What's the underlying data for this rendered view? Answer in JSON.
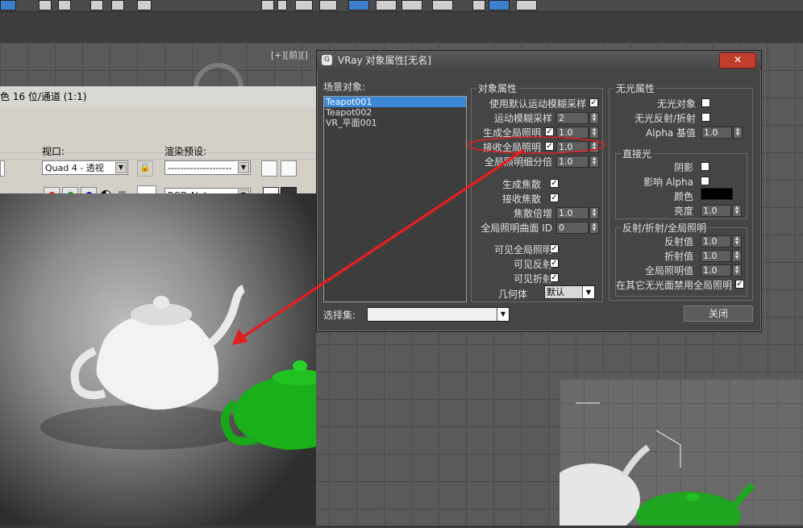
{
  "viewport": {
    "label": "[+][前][]"
  },
  "render_frame": {
    "title_visible": "色 16 位/通道 (1:1)",
    "viewport_label": "视口:",
    "viewport_value": "Quad 4 - 透视",
    "preset_label": "渲染预设:",
    "preset_value": "--------------------",
    "channel_value": "RGB Alpha"
  },
  "dialog": {
    "title": "VRay 对象属性[无名]",
    "close_label": "关闭",
    "scene_objects_label": "场景对象:",
    "objects": [
      "Teapot001",
      "Teapot002",
      "VR_平面001"
    ],
    "selected_object": "Teapot001",
    "selection_set_label": "选择集:",
    "obj_props": {
      "title": "对象属性",
      "use_default_mb": "使用默认运动模糊采样",
      "mb_samples": "运动模糊采样",
      "mb_samples_value": "2",
      "gen_gi": "生成全局照明",
      "gen_gi_value": "1.0",
      "recv_gi": "接收全局照明",
      "recv_gi_value": "1.0",
      "gi_subdiv": "全局照明细分倍",
      "gi_subdiv_value": "1.0",
      "gen_caustics": "生成焦散",
      "recv_caustics": "接收焦散",
      "caustics_mult": "焦散倍增",
      "caustics_mult_value": "1.0",
      "gi_surface_id": "全局照明曲面 ID",
      "gi_surface_id_value": "0",
      "visible_gi": "可见全局照明",
      "visible_refl": "可见反射",
      "visible_refr": "可见折射",
      "geometry": "几何体",
      "geometry_value": "默认"
    },
    "matte_props": {
      "title": "无光属性",
      "matte_object": "无光对象",
      "matte_refl": "无光反射/折射",
      "alpha_base": "Alpha 基值",
      "alpha_base_value": "1.0"
    },
    "direct_light": {
      "title": "直接光",
      "shadows": "阴影",
      "affect_alpha": "影响 Alpha",
      "color": "颜色",
      "brightness": "亮度",
      "brightness_value": "1.0"
    },
    "refl_refr_gi": {
      "title": "反射/折射/全局照明",
      "refl_value": "反射值",
      "refl_value_value": "1.0",
      "refr_value": "折射值",
      "refr_value_value": "1.0",
      "gi_value": "全局照明值",
      "gi_value_value": "1.0",
      "no_gi_other": "在其它无光面禁用全局照明"
    }
  },
  "colors": {
    "accent": "#3b88d8",
    "annotation": "#e02020",
    "close_button": "#c33d2d"
  }
}
